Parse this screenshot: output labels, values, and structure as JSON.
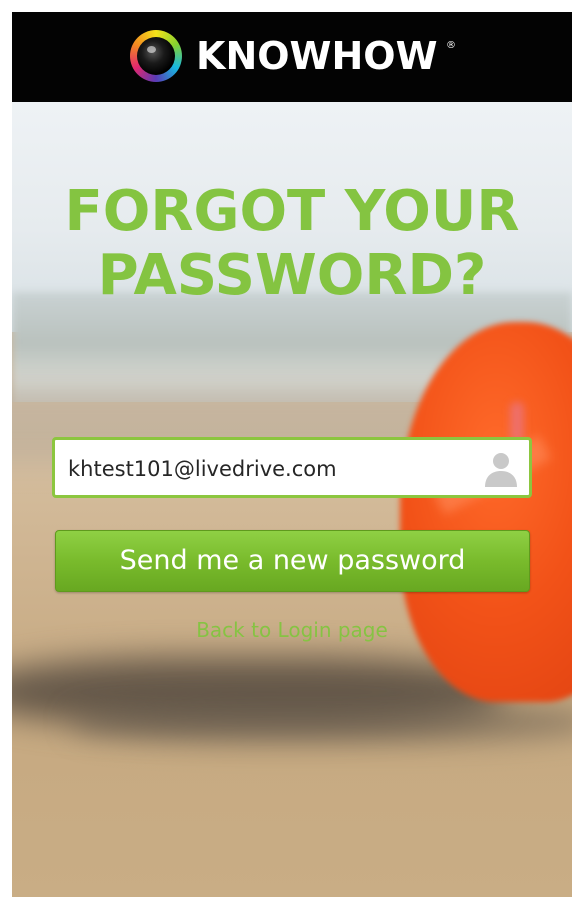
{
  "header": {
    "brand": "KNOWHOW",
    "registered_mark": "®",
    "logo_icon": "camera-lens-ring-icon"
  },
  "main": {
    "title_line1": "FORGOT YOUR",
    "title_line2": "PASSWORD?",
    "email_value": "khtest101@livedrive.com",
    "email_icon": "user-icon",
    "send_button_label": "Send me a new password",
    "back_link_label": "Back to Login page"
  },
  "colors": {
    "accent_green": "#84c441",
    "header_bg": "#030303",
    "button_green": "#79bb2c"
  }
}
